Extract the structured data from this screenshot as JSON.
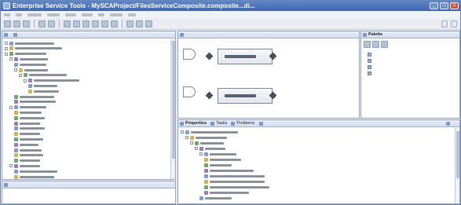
{
  "window": {
    "title": "Enterprise Service Tools - MySCAProject/FilesServiceComposite.composite...di...",
    "min_label": "_",
    "max_label": "□",
    "close_label": "x"
  },
  "toolbar": {
    "persp_1": "",
    "persp_2": ""
  },
  "explorer": {
    "tabs": [
      {
        "label": ""
      },
      {
        "label": ""
      }
    ]
  },
  "outline": {
    "tabs": [
      {
        "label": ""
      }
    ]
  },
  "editor": {
    "tab": ""
  },
  "palette": {
    "title": "Palette",
    "items": [
      {
        "label": "",
        "icon": "component-icon"
      },
      {
        "label": "",
        "icon": "reference-icon"
      },
      {
        "label": "",
        "icon": "service-icon"
      },
      {
        "label": "",
        "icon": "wire-icon"
      }
    ]
  },
  "bottom": {
    "tabs": [
      {
        "label": "Properties"
      },
      {
        "label": "Tasks"
      },
      {
        "label": "Problems"
      },
      {
        "label": ""
      }
    ],
    "right_tab": ""
  },
  "colors": {
    "title_bar": "#4a72b8",
    "selection": "#3f6fd0"
  }
}
